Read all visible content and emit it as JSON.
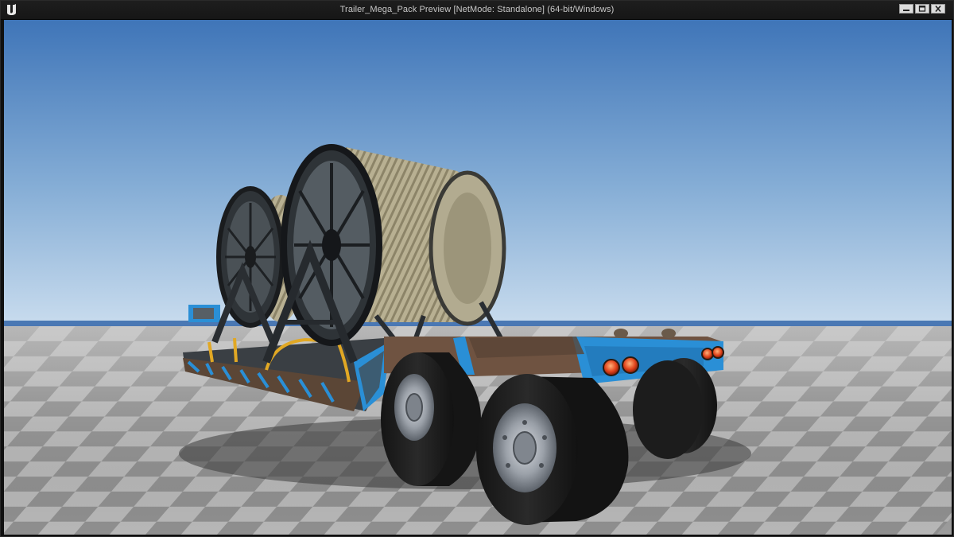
{
  "window": {
    "title": "Trailer_Mega_Pack Preview [NetMode: Standalone]  (64-bit/Windows)",
    "controls": {
      "minimize_icon": "minimize-icon",
      "maximize_icon": "maximize-icon",
      "close_icon": "close-icon"
    },
    "app_icon": "unreal-engine-logo"
  },
  "viewport": {
    "scene": "lowboy-trailer-with-cable-reels",
    "colors": {
      "sky_top": "#3f75b8",
      "sky_horizon": "#c9dcee",
      "floor_light": "#b9b9b9",
      "floor_dark": "#8e8e8e",
      "trailer_blue": "#2a8fd6",
      "rust": "#6b4a35",
      "tire": "#1d1d1d",
      "cable": "#b5ad8c",
      "reel": "#3c4246"
    }
  }
}
